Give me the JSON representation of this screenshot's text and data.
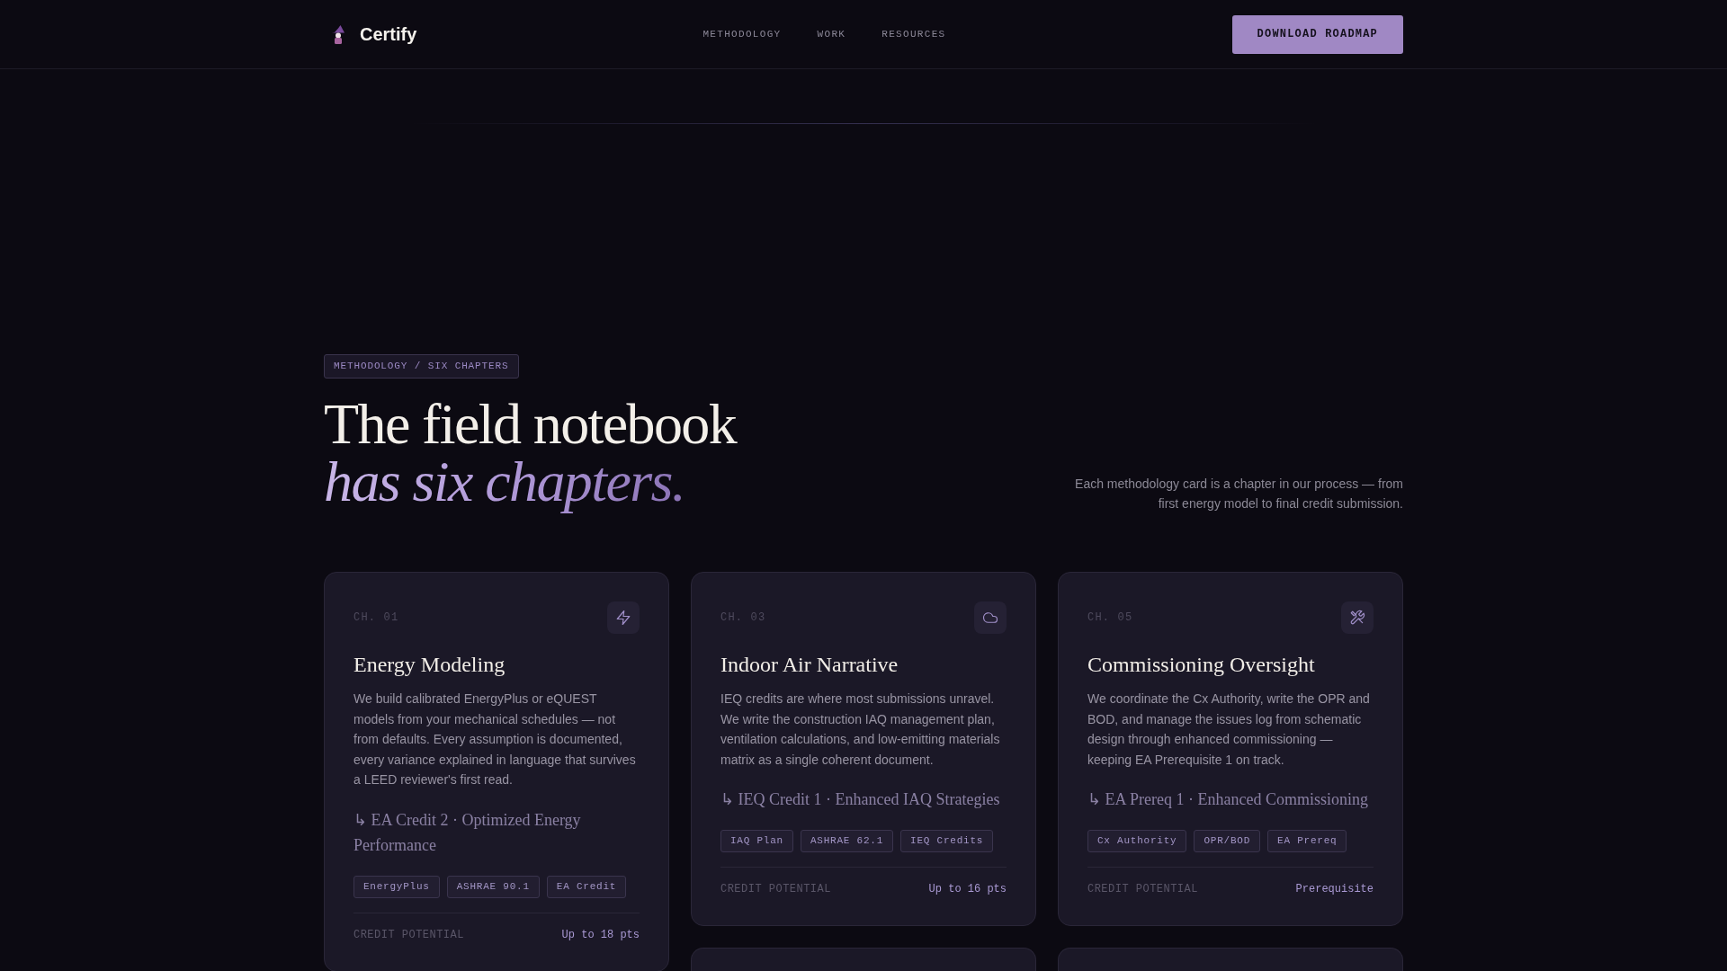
{
  "header": {
    "brand": "Certify",
    "nav": [
      "METHODOLOGY",
      "WORK",
      "RESOURCES"
    ],
    "cta": "DOWNLOAD ROADMAP"
  },
  "intro": {
    "eyebrow": "METHODOLOGY / SIX CHAPTERS",
    "heading": "The field notebook *has six chapters.*",
    "description": "Each methodology card is a chapter in our process — from first energy model to final credit submission."
  },
  "columns": [
    {
      "cards": [
        {
          "chapter": "CH. 01",
          "title": "Energy Modeling",
          "description": "We build calibrated EnergyPlus or eQUEST models from your mechanical schedules — not from defaults. Every assumption is documented, every variance explained in language that survives a LEED reviewer's first read.",
          "credit": "↳ EA Credit 2 · Optimized Energy Performance",
          "tags": [
            "EnergyPlus",
            "ASHRAE 90.1",
            "EA Credit"
          ],
          "footer_label": "CREDIT POTENTIAL",
          "footer_value": "Up to 18 pts"
        }
      ],
      "continues": false
    },
    {
      "cards": [
        {
          "chapter": "CH. 03",
          "title": "Indoor Air Narrative",
          "description": "IEQ credits are where most submissions unravel. We write the construction IAQ management plan, ventilation calculations, and low-emitting materials matrix as a single coherent document.",
          "credit": "↳ IEQ Credit 1 · Enhanced IAQ Strategies",
          "tags": [
            "IAQ Plan",
            "ASHRAE 62.1",
            "IEQ Credits"
          ],
          "footer_label": "CREDIT POTENTIAL",
          "footer_value": "Up to 16 pts"
        }
      ],
      "continues": true
    },
    {
      "cards": [
        {
          "chapter": "CH. 05",
          "title": "Commissioning Oversight",
          "description": "We coordinate the Cx Authority, write the OPR and BOD, and manage the issues log from schematic design through enhanced commissioning — keeping EA Prerequisite 1 on track.",
          "credit": "↳ EA Prereq 1 · Enhanced Commissioning",
          "tags": [
            "Cx Authority",
            "OPR/BOD",
            "EA Prereq"
          ],
          "footer_label": "CREDIT POTENTIAL",
          "footer_value": "Prerequisite"
        }
      ],
      "continues": true
    }
  ]
}
